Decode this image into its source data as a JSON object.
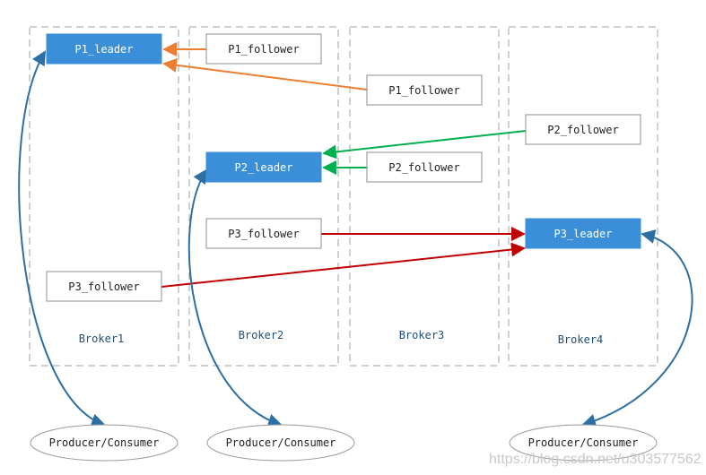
{
  "colors": {
    "leader": "#3a8fd8",
    "p1_arrow": "#ed7d31",
    "p2_arrow": "#00b050",
    "p3_arrow": "#c00000",
    "client_arrow": "#2e6fa3",
    "dashed_border": "#a0a0a0"
  },
  "brokers": [
    {
      "label": "Broker1"
    },
    {
      "label": "Broker2"
    },
    {
      "label": "Broker3"
    },
    {
      "label": "Broker4"
    }
  ],
  "partitions": [
    {
      "label": "P1_leader",
      "role": "leader",
      "broker": "Broker1"
    },
    {
      "label": "P1_follower",
      "role": "follower",
      "broker": "Broker2"
    },
    {
      "label": "P1_follower",
      "role": "follower",
      "broker": "Broker3"
    },
    {
      "label": "P2_follower",
      "role": "follower",
      "broker": "Broker4"
    },
    {
      "label": "P2_leader",
      "role": "leader",
      "broker": "Broker2"
    },
    {
      "label": "P2_follower",
      "role": "follower",
      "broker": "Broker3"
    },
    {
      "label": "P3_follower",
      "role": "follower",
      "broker": "Broker2"
    },
    {
      "label": "P3_leader",
      "role": "leader",
      "broker": "Broker4"
    },
    {
      "label": "P3_follower",
      "role": "follower",
      "broker": "Broker1"
    }
  ],
  "clients": [
    {
      "label": "Producer/Consumer"
    },
    {
      "label": "Producer/Consumer"
    },
    {
      "label": "Producer/Consumer"
    }
  ],
  "watermark": "https://blog.csdn.net/u303577562"
}
